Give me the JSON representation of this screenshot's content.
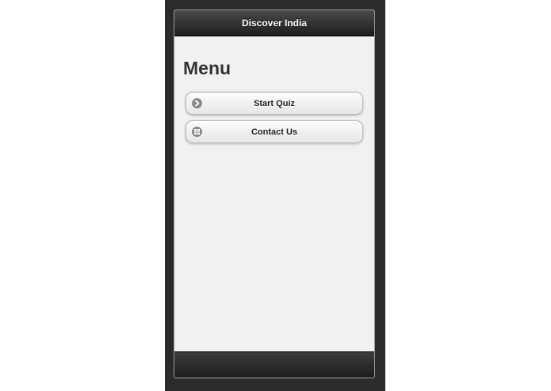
{
  "header": {
    "title": "Discover India"
  },
  "main": {
    "heading": "Menu",
    "buttons": [
      {
        "label": "Start Quiz",
        "icon": "arrow-right-icon"
      },
      {
        "label": "Contact Us",
        "icon": "grid-icon"
      }
    ]
  },
  "colors": {
    "toolbar": "#1e1e1e",
    "page_background": "#f1f1f1",
    "button_icon": "#8a8a8a"
  }
}
